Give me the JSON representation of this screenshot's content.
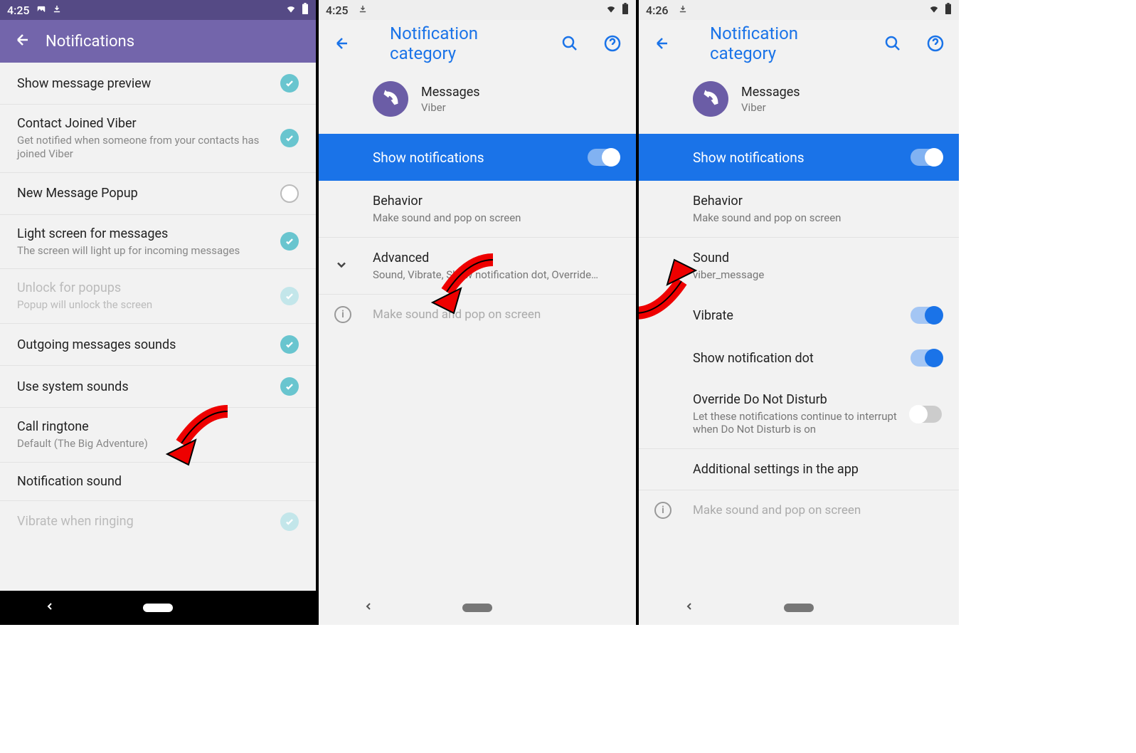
{
  "panel1": {
    "status_time": "4:25",
    "header_title": "Notifications",
    "items": [
      {
        "title": "Show message preview",
        "sub": "",
        "state": "on"
      },
      {
        "title": "Contact Joined Viber",
        "sub": "Get notified when someone from your contacts has joined Viber",
        "state": "on"
      },
      {
        "title": "New Message Popup",
        "sub": "",
        "state": "off"
      },
      {
        "title": "Light screen for messages",
        "sub": "The screen will light up for incoming messages",
        "state": "on"
      },
      {
        "title": "Unlock for popups",
        "sub": "Popup will unlock the screen",
        "state": "dim",
        "disabled": true
      },
      {
        "title": "Outgoing messages sounds",
        "sub": "",
        "state": "on"
      },
      {
        "title": "Use system sounds",
        "sub": "",
        "state": "on"
      },
      {
        "title": "Call ringtone",
        "sub": "Default (The Big Adventure)",
        "state": ""
      },
      {
        "title": "Notification sound",
        "sub": "",
        "state": ""
      },
      {
        "title": "Vibrate when ringing",
        "sub": "",
        "state": "dim",
        "disabled": true
      }
    ]
  },
  "panel2": {
    "status_time": "4:25",
    "header_title": "Notification category",
    "app_name": "Messages",
    "app_vendor": "Viber",
    "show_notifications_label": "Show notifications",
    "behavior_title": "Behavior",
    "behavior_sub": "Make sound and pop on screen",
    "advanced_title": "Advanced",
    "advanced_sub": "Sound, Vibrate, Show notification dot, Override…",
    "hint": "Make sound and pop on screen"
  },
  "panel3": {
    "status_time": "4:26",
    "header_title": "Notification category",
    "app_name": "Messages",
    "app_vendor": "Viber",
    "show_notifications_label": "Show notifications",
    "behavior_title": "Behavior",
    "behavior_sub": "Make sound and pop on screen",
    "sound_title": "Sound",
    "sound_sub": "viber_message",
    "vibrate_label": "Vibrate",
    "dot_label": "Show notification dot",
    "dnd_title": "Override Do Not Disturb",
    "dnd_sub": "Let these notifications continue to interrupt when Do Not Disturb is on",
    "additional_label": "Additional settings in the app",
    "hint": "Make sound and pop on screen"
  }
}
